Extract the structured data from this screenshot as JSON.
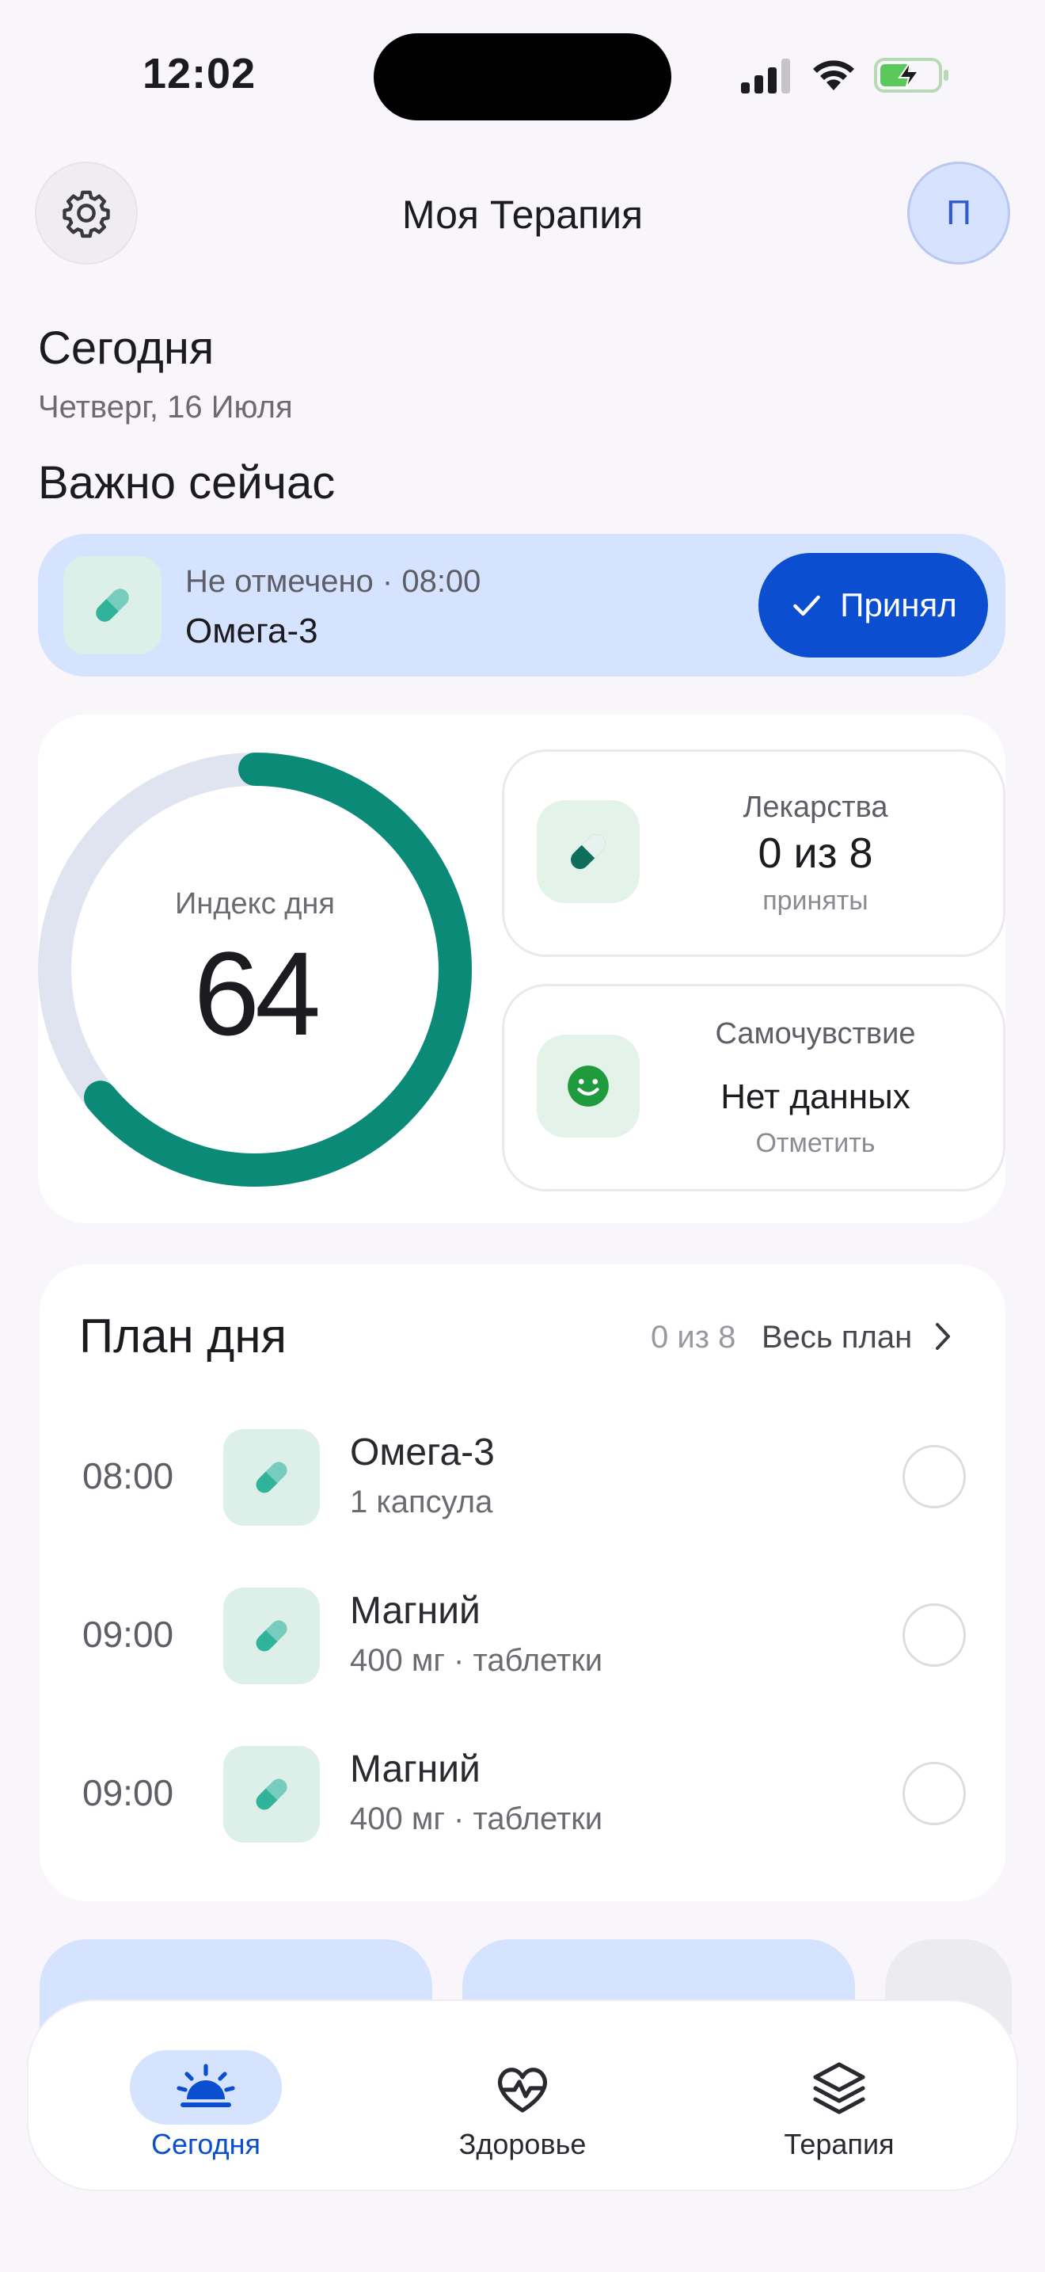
{
  "status_bar": {
    "time": "12:02"
  },
  "header": {
    "title": "Моя Терапия",
    "avatar_letter": "П"
  },
  "today": {
    "label": "Сегодня",
    "date": "Четверг, 16 Июля"
  },
  "important": {
    "label": "Важно сейчас",
    "status": "Не отмечено · 08:00",
    "name": "Омега-3",
    "button_label": "Принял"
  },
  "day_index": {
    "label": "Индекс дня",
    "value": "64",
    "progress_fraction": 0.64
  },
  "medicines_card": {
    "title": "Лекарства",
    "value": "0 из 8",
    "subtitle": "приняты"
  },
  "wellbeing_card": {
    "title": "Самочувствие",
    "value": "Нет данных",
    "subtitle": "Отметить"
  },
  "plan": {
    "title": "План дня",
    "count": "0 из 8",
    "all_label": "Весь план",
    "items": [
      {
        "time": "08:00",
        "name": "Омега-3",
        "dose": "1 капсула"
      },
      {
        "time": "09:00",
        "name": "Магний",
        "dose": "400 мг · таблетки"
      },
      {
        "time": "09:00",
        "name": "Магний",
        "dose": "400 мг · таблетки"
      }
    ]
  },
  "bottom_nav": {
    "items": [
      {
        "label": "Сегодня",
        "active": true
      },
      {
        "label": "Здоровье",
        "active": false
      },
      {
        "label": "Терапия",
        "active": false
      }
    ]
  },
  "colors": {
    "accent": "#0b4fd0",
    "ring_progress": "#0b8a77",
    "ring_track": "#e0e4f0",
    "pill_icon": "#2fb39a",
    "smile_icon": "#1f9a3d"
  }
}
